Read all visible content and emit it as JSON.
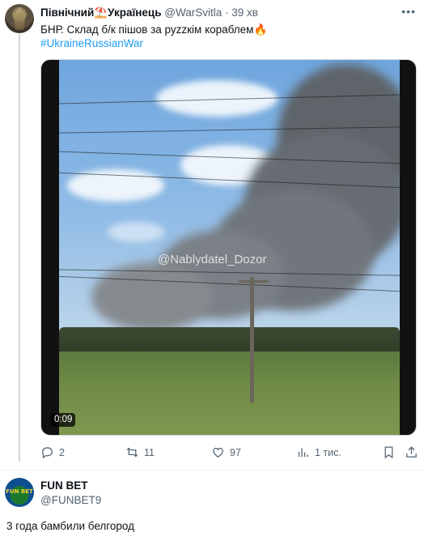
{
  "tweet": {
    "author_name": "Північний⛱️Українець",
    "handle": "@WarSvitla",
    "separator": "·",
    "time": "39 хв",
    "text": "БНР. Склад б/к пішов за руzzкім кораблем🔥",
    "hashtag": "#UkraineRussianWar",
    "media": {
      "watermark": "@Nablydatel_Dozor",
      "duration": "0:09"
    },
    "actions": {
      "replies": "2",
      "retweets": "11",
      "likes": "97",
      "views": "1 тис."
    }
  },
  "reply": {
    "author_name": "FUN BET",
    "handle": "@FUNBET9",
    "avatar_text": "FUN BET",
    "text": "3 года  бамбили белгород"
  }
}
